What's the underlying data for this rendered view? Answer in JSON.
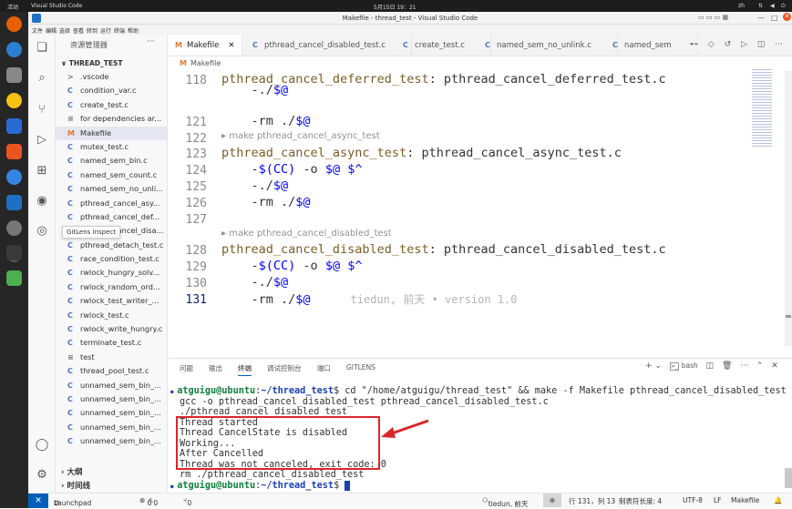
{
  "ubuntu": {
    "activities": "活动",
    "app_name": "Visual Studio Code",
    "clock": "5月15日 19：21",
    "lang": "zh"
  },
  "window": {
    "title": "Makefile - thread_test - Visual Studio Code"
  },
  "menu": [
    "文件",
    "编辑",
    "选择",
    "查看",
    "转到",
    "运行",
    "终端",
    "帮助"
  ],
  "sidebar": {
    "header": "资源管理器",
    "folder": "THREAD_TEST",
    "items": [
      {
        "label": ".vscode",
        "icon": ">"
      },
      {
        "label": "condition_var.c",
        "icon": "C"
      },
      {
        "label": "create_test.c",
        "icon": "C"
      },
      {
        "label": "for dependencies ar...",
        "icon": "≡"
      },
      {
        "label": "Makefile",
        "icon": "M"
      },
      {
        "label": "mutex_test.c",
        "icon": "C"
      },
      {
        "label": "named_sem_bin.c",
        "icon": "C"
      },
      {
        "label": "named_sem_count.c",
        "icon": "C"
      },
      {
        "label": "named_sem_no_unli...",
        "icon": "C"
      },
      {
        "label": "pthread_cancel_asy...",
        "icon": "C"
      },
      {
        "label": "pthread_cancel_def...",
        "icon": "C"
      },
      {
        "label": "pthread_cancel_disa...",
        "icon": "C"
      },
      {
        "label": "pthread_detach_test.c",
        "icon": "C"
      },
      {
        "label": "race_condition_test.c",
        "icon": "C"
      },
      {
        "label": "rwlock_hungry_solv...",
        "icon": "C"
      },
      {
        "label": "rwlock_random_ord...",
        "icon": "C"
      },
      {
        "label": "rwlock_test_writer_...",
        "icon": "C"
      },
      {
        "label": "rwlock_test.c",
        "icon": "C"
      },
      {
        "label": "rwlock_write_hungry.c",
        "icon": "C"
      },
      {
        "label": "terminate_test.c",
        "icon": "C"
      },
      {
        "label": "test",
        "icon": "≡"
      },
      {
        "label": "thread_pool_test.c",
        "icon": "C"
      },
      {
        "label": "unnamed_sem_bin_...",
        "icon": "C"
      },
      {
        "label": "unnamed_sem_bin_...",
        "icon": "C"
      },
      {
        "label": "unnamed_sem_bin_...",
        "icon": "C"
      },
      {
        "label": "unnamed_sem_bin_...",
        "icon": "C"
      },
      {
        "label": "unnamed_sem_bin_...",
        "icon": "C"
      }
    ],
    "outline": "大纲",
    "timeline": "时间线",
    "tooltip": "GitLens Inspect"
  },
  "tabs": [
    {
      "label": "Makefile",
      "icon": "M",
      "active": true
    },
    {
      "label": "pthread_cancel_disabled_test.c",
      "icon": "C"
    },
    {
      "label": "create_test.c",
      "icon": "C"
    },
    {
      "label": "named_sem_no_unlink.c",
      "icon": "C"
    },
    {
      "label": "named_sem",
      "icon": "C"
    }
  ],
  "breadcrumb": "Makefile",
  "editor": {
    "lines": [
      {
        "no": "118",
        "tgt": "pthread_cancel_deferred_test",
        "dep": "pthread_cancel_deferred_test.c"
      },
      {
        "no": "",
        "cmd": "-./$@"
      },
      {
        "no": "121",
        "cmd": "-rm ./$@"
      },
      {
        "no": "122",
        "cmd": ""
      },
      {
        "lens": "make pthread_cancel_async_test"
      },
      {
        "no": "123",
        "tgt": "pthread_cancel_async_test",
        "dep": "pthread_cancel_async_test.c"
      },
      {
        "no": "124",
        "cmd": "-$(CC) -o $@ $^"
      },
      {
        "no": "125",
        "cmd": "-./$@"
      },
      {
        "no": "126",
        "cmd": "-rm ./$@"
      },
      {
        "no": "127",
        "cmd": ""
      },
      {
        "lens": "make pthread_cancel_disabled_test"
      },
      {
        "no": "128",
        "tgt": "pthread_cancel_disabled_test",
        "dep": "pthread_cancel_disabled_test.c"
      },
      {
        "no": "129",
        "cmd": "-$(CC) -o $@ $^"
      },
      {
        "no": "130",
        "cmd": "-./$@"
      },
      {
        "no": "131",
        "cmd": "-rm ./$@",
        "blame": "tiedun, 前天 • version 1.0"
      }
    ]
  },
  "panel": {
    "tabs": [
      "问题",
      "输出",
      "终端",
      "调试控制台",
      "端口",
      "GITLENS"
    ],
    "active_tab": "终端",
    "shell": "bash",
    "terminal": [
      {
        "prompt_user": "atguigu@ubuntu",
        "prompt_path": "~/thread_test",
        "cmd": "$ cd \"/home/atguigu/thread_test\" && make -f Makefile pthread_cancel_disabled_test"
      },
      {
        "text": "gcc -o pthread_cancel_disabled_test pthread_cancel_disabled_test.c"
      },
      {
        "text": "./pthread_cancel_disabled_test"
      },
      {
        "text": "Thread started"
      },
      {
        "text": "Thread CancelState is disabled"
      },
      {
        "text": "Working..."
      },
      {
        "text": "After Cancelled"
      },
      {
        "text": "Thread was not canceled, exit code: 0"
      },
      {
        "text": "rm ./pthread_cancel_disabled_test"
      },
      {
        "prompt_user": "atguigu@ubuntu",
        "prompt_path": "~/thread_test",
        "cmd": "$ "
      }
    ]
  },
  "status": {
    "remote": "✕",
    "launchpad": "Launchpad",
    "errors": "0",
    "warnings": "0",
    "ports": "0",
    "blame": "tiedun, 前天",
    "position": "行 131，列 13",
    "tabsize": "制表符长度: 4",
    "encoding": "UTF-8",
    "eol": "LF",
    "language": "Makefile"
  },
  "colors": {
    "accent": "#005fb8",
    "highlight_box": "#d9262c",
    "arrow": "#d9262c"
  }
}
